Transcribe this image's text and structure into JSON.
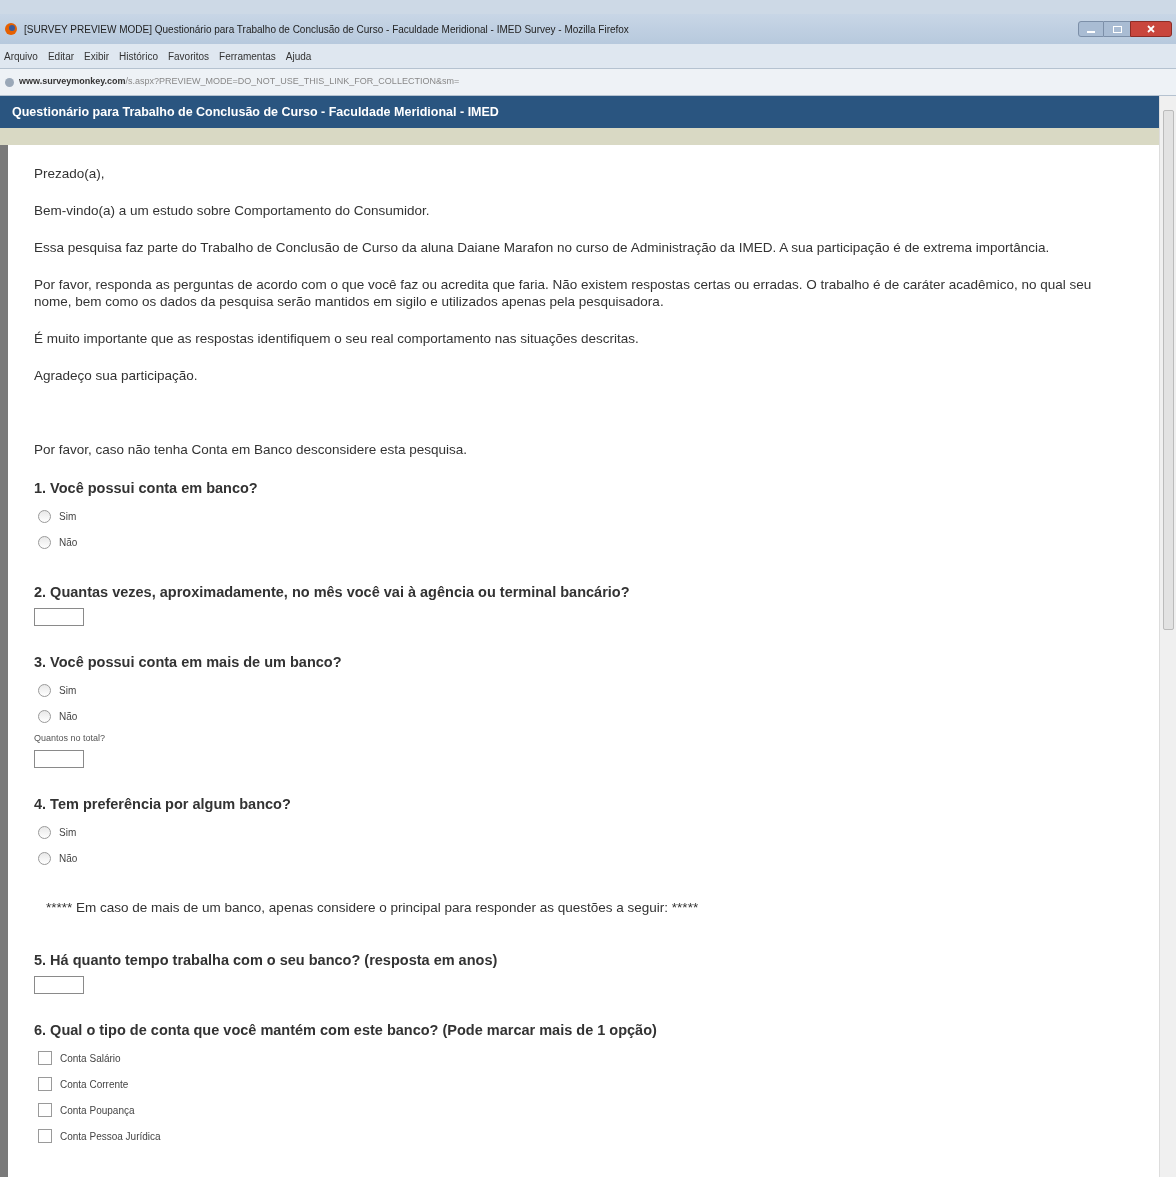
{
  "window": {
    "title": "[SURVEY PREVIEW MODE] Questionário para Trabalho de Conclusão de Curso - Faculdade Meridional - IMED Survey - Mozilla Firefox"
  },
  "menu": [
    "Arquivo",
    "Editar",
    "Exibir",
    "Histórico",
    "Favoritos",
    "Ferramentas",
    "Ajuda"
  ],
  "address_bar": {
    "domain": "www.surveymonkey.com",
    "path": "/s.aspx?PREVIEW_MODE=DO_NOT_USE_THIS_LINK_FOR_COLLECTION&sm="
  },
  "survey": {
    "title": "Questionário para Trabalho de Conclusão de Curso - Faculdade Meridional - IMED",
    "items": [
      {
        "kind": "paragraph",
        "text": "Prezado(a),"
      },
      {
        "kind": "paragraph",
        "text": "Bem-vindo(a) a um estudo sobre Comportamento do Consumidor."
      },
      {
        "kind": "paragraph",
        "text": "Essa pesquisa faz parte do Trabalho de Conclusão de Curso da aluna Daiane Marafon no curso de Administração da IMED. A sua participação é de extrema importância."
      },
      {
        "kind": "paragraph",
        "text": "Por favor, responda as perguntas de acordo com o que você faz ou acredita que faria. Não existem respostas certas ou erradas. O trabalho é de caráter acadêmico, no qual seu nome, bem como os dados da pesquisa serão mantidos em sigilo e utilizados apenas pela pesquisadora."
      },
      {
        "kind": "paragraph",
        "text": "É muito importante que as respostas identifiquem o seu real comportamento nas situações descritas."
      },
      {
        "kind": "paragraph",
        "text": "Agradeço sua participação."
      },
      {
        "kind": "spacer"
      },
      {
        "kind": "paragraph",
        "text": "Por favor, caso não tenha Conta em Banco desconsidere esta pesquisa."
      },
      {
        "kind": "question",
        "title": "1. Você possui conta em banco?",
        "elements": [
          {
            "kind": "radio",
            "label": "Sim",
            "selected": false
          },
          {
            "kind": "radio",
            "label": "Não",
            "selected": false
          }
        ]
      },
      {
        "kind": "question",
        "title": "2. Quantas vezes, aproximadamente, no mês você vai à agência ou terminal bancário?",
        "elements": [
          {
            "kind": "textbox"
          }
        ]
      },
      {
        "kind": "question",
        "title": "3. Você possui conta em mais de um banco?",
        "elements": [
          {
            "kind": "radio",
            "label": "Sim",
            "selected": false
          },
          {
            "kind": "radio",
            "label": "Não",
            "selected": false
          },
          {
            "kind": "caption",
            "text": "Quantos no total?"
          },
          {
            "kind": "textbox"
          }
        ]
      },
      {
        "kind": "question",
        "title": "4. Tem preferência por algum banco?",
        "elements": [
          {
            "kind": "radio",
            "label": "Sim",
            "selected": false
          },
          {
            "kind": "radio",
            "label": "Não",
            "selected": false
          }
        ]
      },
      {
        "kind": "note",
        "text": "***** Em caso de mais de um banco, apenas considere o principal para responder as questões a seguir: *****"
      },
      {
        "kind": "question",
        "title": "5. Há quanto tempo trabalha com o seu banco? (resposta em anos)",
        "elements": [
          {
            "kind": "textbox"
          }
        ]
      },
      {
        "kind": "question",
        "title": "6. Qual o tipo de conta que você mantém com este banco? (Pode marcar mais de 1 opção)",
        "elements": [
          {
            "kind": "checkbox",
            "label": "Conta Salário",
            "checked": false
          },
          {
            "kind": "checkbox",
            "label": "Conta Corrente",
            "checked": false
          },
          {
            "kind": "checkbox",
            "label": "Conta Poupança",
            "checked": false
          },
          {
            "kind": "checkbox",
            "label": "Conta Pessoa Jurídica",
            "checked": false
          }
        ]
      }
    ]
  }
}
